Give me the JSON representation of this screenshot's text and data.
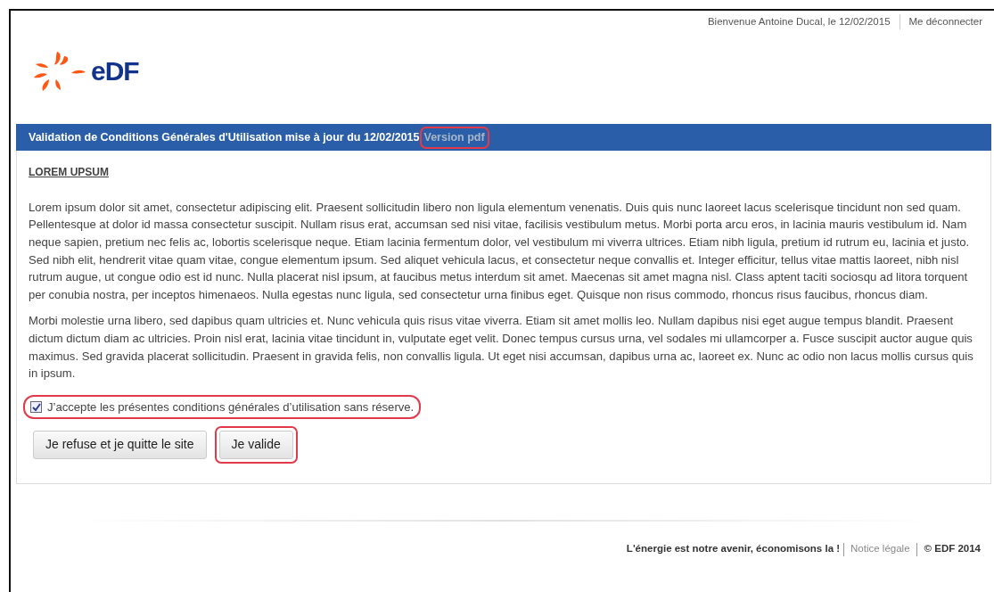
{
  "header": {
    "welcome": "Bienvenue Antoine Ducal, le 12/02/2015",
    "logout": "Me déconnecter",
    "logo_text": "eDF"
  },
  "panel": {
    "title": "Validation de Conditions Générales d'Utilisation mise à jour du 12/02/2015",
    "pdf_link": {
      "label": "Version pdf",
      "highlighted": true
    },
    "heading": "LOREM UPSUM",
    "paragraphs": [
      "Lorem ipsum dolor sit amet, consectetur adipiscing elit. Praesent sollicitudin libero non ligula elementum venenatis. Duis quis nunc laoreet lacus scelerisque tincidunt non sed quam. Pellentesque at dolor id massa consectetur suscipit. Nullam risus erat, accumsan sed nisi vitae, facilisis vestibulum metus. Morbi porta arcu eros, in lacinia mauris vestibulum id. Nam neque sapien, pretium nec felis ac, lobortis scelerisque neque. Etiam lacinia fermentum dolor, vel vestibulum mi viverra ultrices. Etiam nibh ligula, pretium id rutrum eu, lacinia et justo. Sed nibh elit, hendrerit vitae quam vitae, congue elementum ipsum. Sed aliquet vehicula lacus, et consectetur neque convallis et. Integer efficitur, tellus vitae mattis laoreet, nibh nisl rutrum augue, ut congue odio est id nunc. Nulla placerat nisl ipsum, at faucibus metus interdum sit amet. Maecenas sit amet magna nisl. Class aptent taciti sociosqu ad litora torquent per conubia nostra, per inceptos himenaeos. Nulla egestas nunc ligula, sed consectetur urna finibus eget. Quisque non risus commodo, rhoncus risus faucibus, rhoncus diam.",
      "Morbi molestie urna libero, sed dapibus quam ultricies et. Nunc vehicula quis risus vitae viverra. Etiam sit amet mollis leo. Nullam dapibus nisi eget augue tempus blandit. Praesent dictum dictum diam ac ultricies. Proin nisl erat, lacinia vitae tincidunt in, vulputate eget velit. Donec tempus cursus urna, vel sodales mi ullamcorper a. Fusce suscipit auctor augue quis maximus. Sed gravida placerat sollicitudin. Praesent in gravida felis, non convallis ligula. Ut eget nisi accumsan, dapibus urna ac, laoreet ex. Nunc ac odio non lacus mollis cursus quis in ipsum."
    ],
    "accept": {
      "label": "J’accepte les présentes conditions générales d’utilisation sans réserve.",
      "checked": true,
      "highlighted": true
    },
    "buttons": [
      {
        "label": "Je refuse et je quitte le site",
        "highlighted": false
      },
      {
        "label": "Je valide",
        "highlighted": true
      }
    ]
  },
  "footer": {
    "slogan": "L'énergie est notre avenir, économisons la !",
    "legal": "Notice légale",
    "copyright": "© EDF 2014"
  }
}
